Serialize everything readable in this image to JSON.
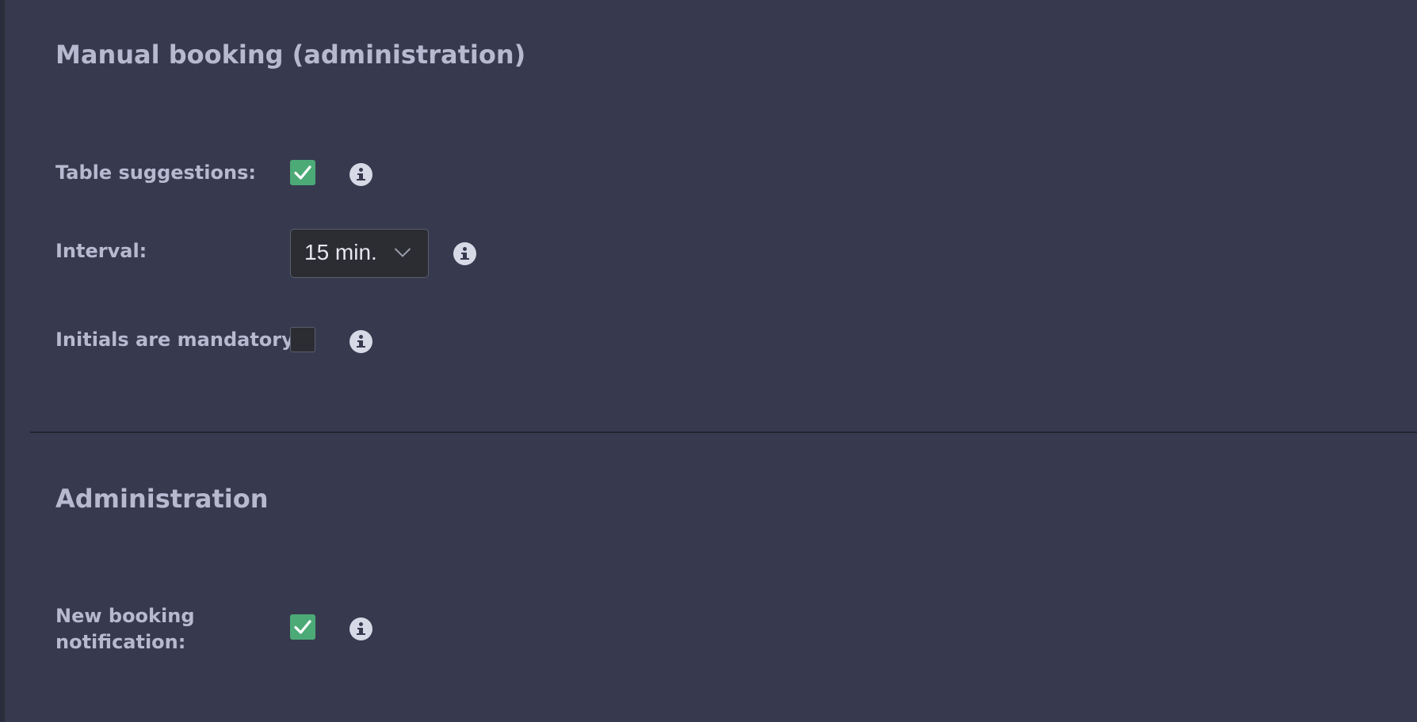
{
  "sections": [
    {
      "title": "Manual booking (administration)",
      "rows": [
        {
          "label": "Table suggestions:",
          "control": "checkbox",
          "checked": true,
          "info_icon": "info-icon"
        },
        {
          "label": "Interval:",
          "control": "select",
          "value": "15 min.",
          "dropdown_icon": "chevron-down-icon",
          "info_icon": "info-icon"
        },
        {
          "label": "Initials are mandatory:",
          "control": "checkbox",
          "checked": false,
          "info_icon": "info-icon"
        }
      ]
    },
    {
      "title": "Administration",
      "rows": [
        {
          "label_lines": [
            "New booking",
            "notification:"
          ],
          "control": "checkbox",
          "checked": true,
          "info_icon": "info-icon"
        }
      ]
    }
  ],
  "colors": {
    "background": "#373a4f",
    "text": "#b7b9d1",
    "checkbox_checked": "#4caa77",
    "control_background": "#2b2d33",
    "info_icon": "#d8d9e6"
  }
}
